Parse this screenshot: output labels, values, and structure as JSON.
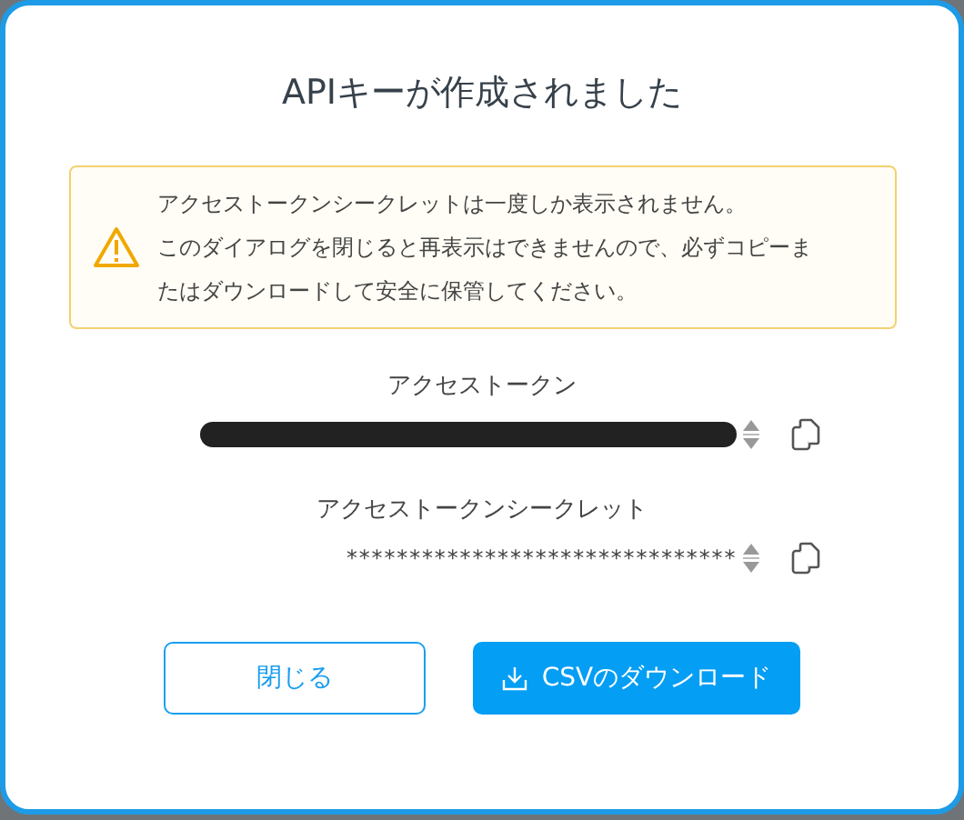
{
  "dialog": {
    "title": "APIキーが作成されました",
    "warning": {
      "lines": [
        "アクセストークンシークレットは一度しか表示されません。",
        "このダイアログを閉じると再表示はできませんので、必ずコピーま",
        "たはダウンロードして安全に保管してください。"
      ]
    },
    "fields": [
      {
        "label": "アクセストークン",
        "kind": "redacted"
      },
      {
        "label": "アクセストークンシークレット",
        "kind": "masked",
        "value": "*******************************"
      }
    ],
    "buttons": [
      {
        "label": "閉じる",
        "kind": "outline"
      },
      {
        "label": "CSVのダウンロード",
        "kind": "primary"
      }
    ]
  }
}
